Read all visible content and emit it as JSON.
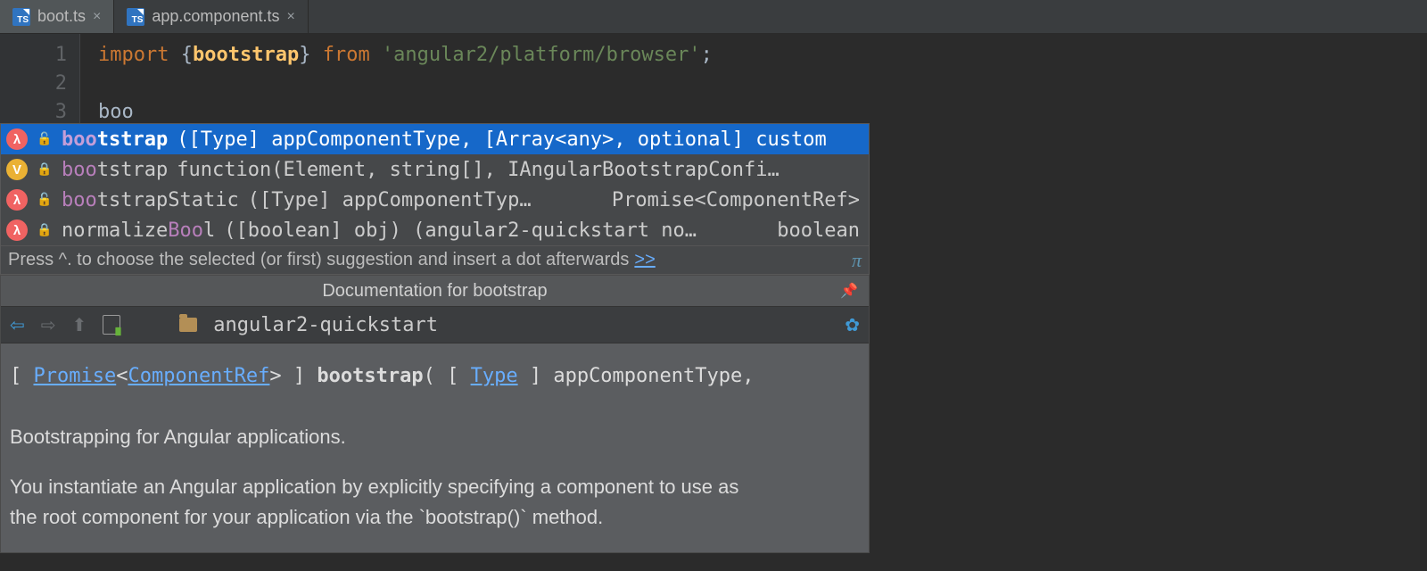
{
  "tabs": [
    {
      "name": "boot.ts",
      "active": true
    },
    {
      "name": "app.component.ts",
      "active": false
    }
  ],
  "editor": {
    "lines": [
      "1",
      "2",
      "3"
    ],
    "line1": {
      "kw": "import",
      "brace1": " {",
      "fn": "bootstrap",
      "brace2": "} ",
      "from": "from ",
      "str": "'angular2/platform/browser'",
      "semi": ";"
    },
    "line3": "boo"
  },
  "completion": {
    "items": [
      {
        "kind": "λ",
        "kindClass": "k-lambda",
        "lock": "🔓",
        "match": "boo",
        "rest": "tstrap",
        "sig": "([Type] appComponentType, [Array<any>, optional] custom",
        "ret": ""
      },
      {
        "kind": "V",
        "kindClass": "k-var",
        "lock": "🔒",
        "match": "boo",
        "rest": "tstrap",
        "sig": "   function(Element, string[], IAngularBootstrapConfi…",
        "ret": ""
      },
      {
        "kind": "λ",
        "kindClass": "k-lambda",
        "lock": "🔓",
        "match": "boo",
        "rest": "tstrapStatic",
        "sig": "([Type] appComponentTyp…",
        "ret": "Promise<ComponentRef>"
      },
      {
        "kind": "λ",
        "kindClass": "k-lambda",
        "lock": "🔒",
        "match": "",
        "rest": "normalize",
        "extraMatch": "Boo",
        "extra": "l",
        "sig": "([boolean] obj) (angular2-quickstart no…",
        "ret": "boolean"
      }
    ],
    "hint": "Press ^. to choose the selected (or first) suggestion and insert a dot afterwards",
    "hintLink": ">>",
    "pi": "π"
  },
  "doc": {
    "title": "Documentation for bootstrap",
    "pkg": "angular2-quickstart",
    "sig": {
      "open": "[ ",
      "promise": "Promise",
      "lt": "<",
      "compref": "ComponentRef",
      "gt": "> ] ",
      "name": "bootstrap",
      "paren": "( [ ",
      "type": "Type",
      "close": " ] appComponentType,"
    },
    "p1": "Bootstrapping for Angular applications.",
    "p2": "You instantiate an Angular application by explicitly specifying a component to use as the root component for your application via the `bootstrap()` method."
  }
}
